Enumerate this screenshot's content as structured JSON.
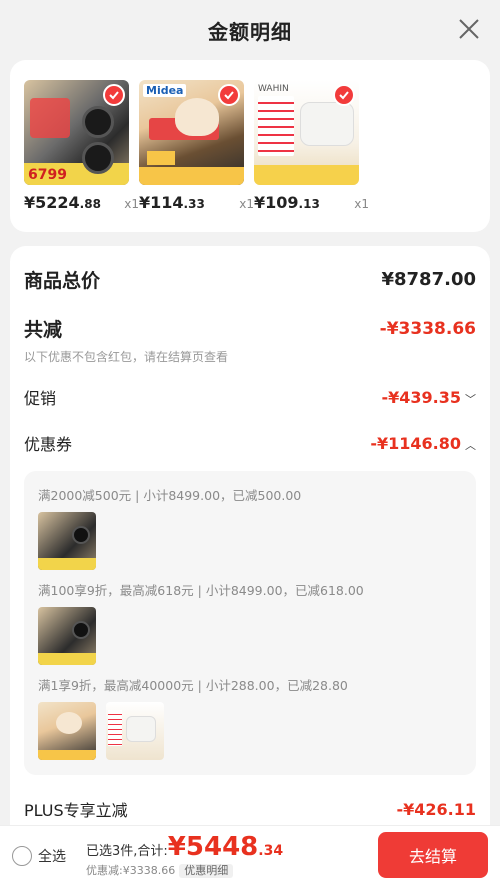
{
  "header": {
    "title": "金额明细"
  },
  "products": [
    {
      "price_int": "¥5224",
      "price_dec": ".88",
      "qty": "x1",
      "thumb_label": "6799"
    },
    {
      "price_int": "¥114",
      "price_dec": ".33",
      "qty": "x1",
      "thumb_label": "Midea"
    },
    {
      "price_int": "¥109",
      "price_dec": ".13",
      "qty": "x1",
      "thumb_label": "WAHIN"
    }
  ],
  "detail": {
    "goods_total_label": "商品总价",
    "goods_total_value": "¥8787.00",
    "total_discount_label": "共减",
    "total_discount_value": "-¥3338.66",
    "note": "以下优惠不包含红包，请在结算页查看",
    "promo_label": "促销",
    "promo_value": "-¥439.35",
    "coupon_label": "优惠券",
    "coupon_value": "-¥1146.80",
    "coupon_lines": [
      "满2000减500元 | 小计8499.00，已减500.00",
      "满100享9折，最高减618元 | 小计8499.00，已减618.00",
      "满1享9折，最高减40000元 | 小计288.00，已减28.80"
    ],
    "plus_label": "PLUS专享立减",
    "plus_value": "-¥426.11"
  },
  "bottom": {
    "select_all": "全选",
    "selected_text": "已选3件,合计:",
    "total_int": "¥5448",
    "total_dec": ".34",
    "discount_text": "优惠减:¥3338.66",
    "detail_tag": "优惠明细",
    "checkout": "去结算"
  },
  "colors": {
    "accent": "#e8311f",
    "checkout_bg": "#ef3b36"
  }
}
